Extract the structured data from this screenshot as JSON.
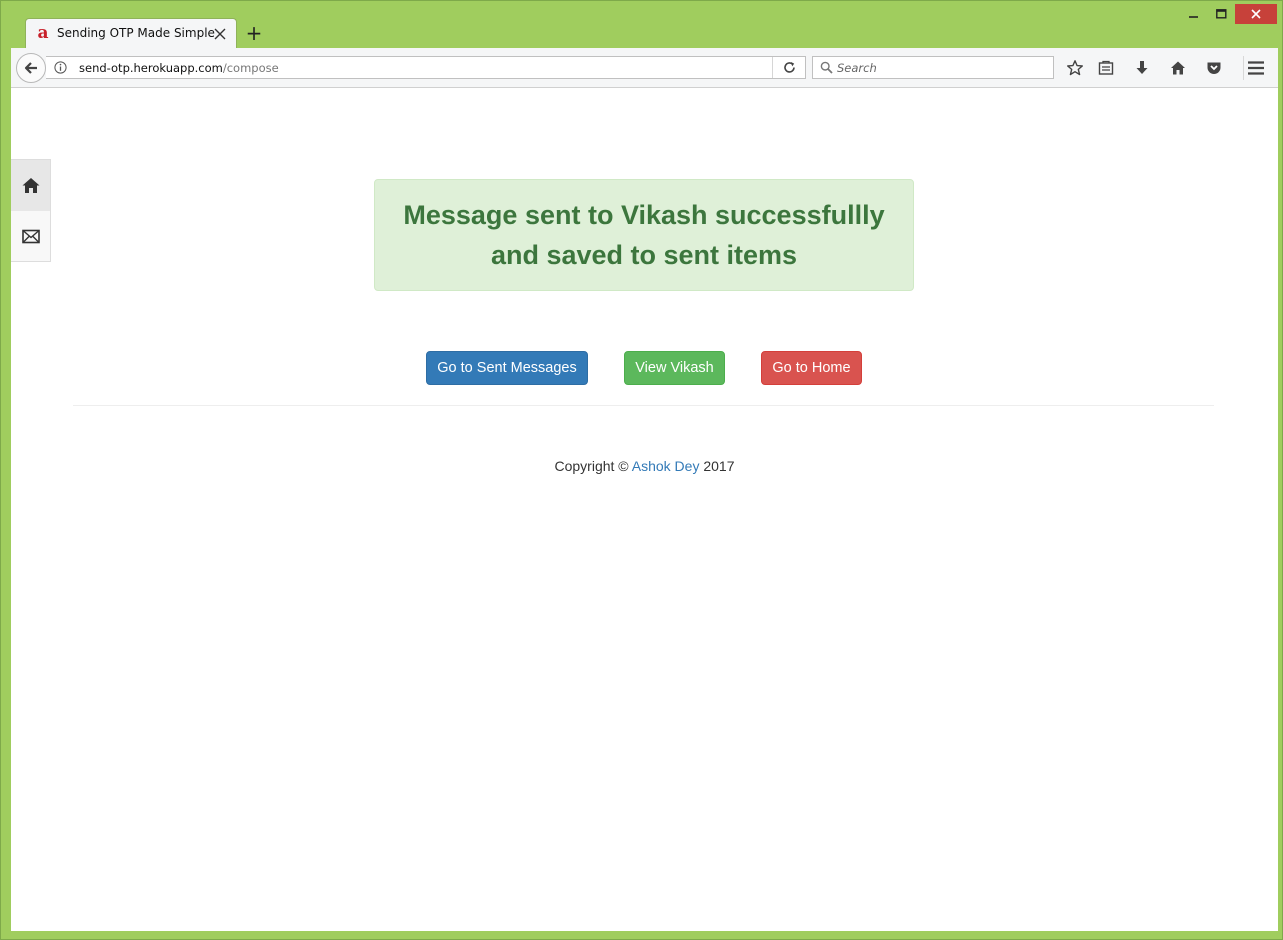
{
  "browser": {
    "tab_title": "Sending OTP Made Simple",
    "favicon_glyph": "a",
    "url_domain": "send-otp.herokuapp.com",
    "url_path": "/compose",
    "search_placeholder": "Search",
    "accent_color": "#a0cd5e"
  },
  "sidenav": {
    "items": [
      {
        "icon": "home-icon",
        "active": true
      },
      {
        "icon": "mail-icon",
        "active": false
      }
    ]
  },
  "alert": {
    "message": "Message sent to Vikash successfullly and saved to sent items",
    "color": "#3c763d",
    "background": "#dff0d8"
  },
  "actions": {
    "sent_messages_label": "Go to Sent Messages",
    "view_contact_label": "View Vikash",
    "home_label": "Go to Home"
  },
  "footer": {
    "prefix": "Copyright ©",
    "author": "Ashok Dey",
    "year": "2017"
  }
}
